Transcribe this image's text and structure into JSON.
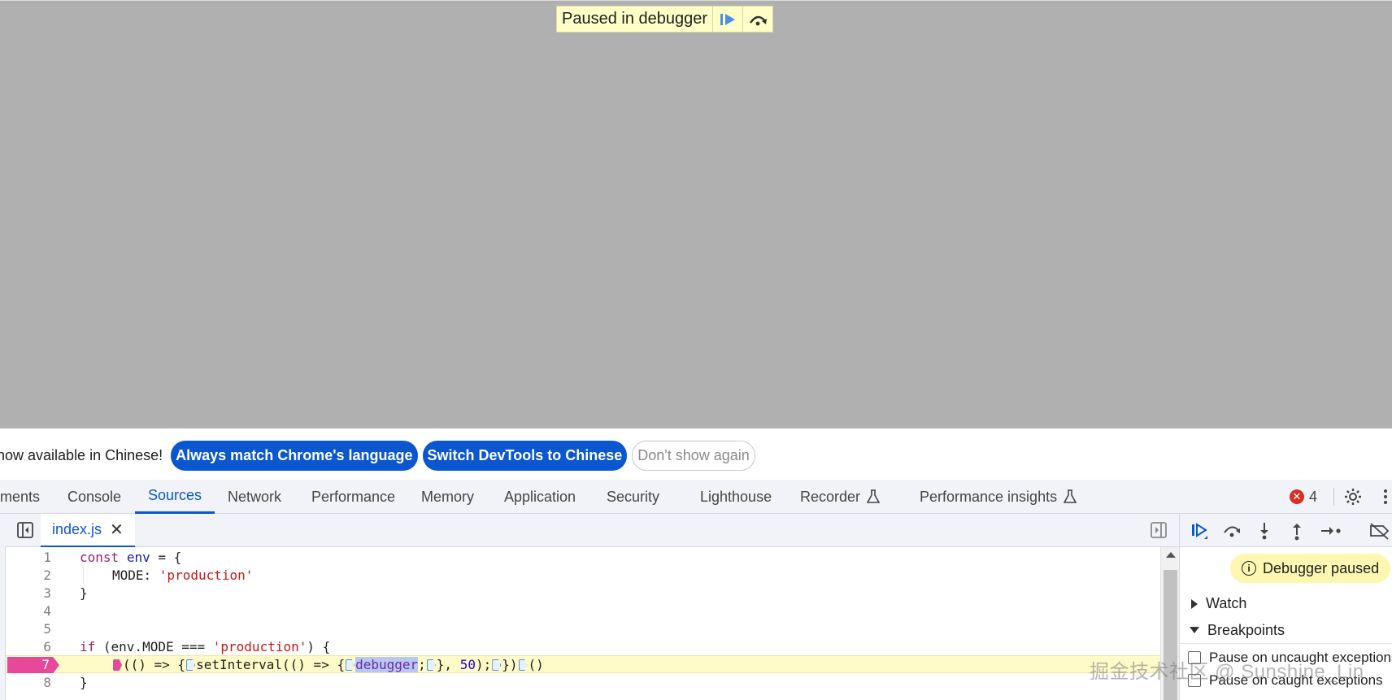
{
  "viewport": {
    "paused_label": "Paused in debugger"
  },
  "lang_bar": {
    "message": "now available in Chinese!",
    "always_match": "Always match Chrome's language",
    "switch_devtools": "Switch DevTools to Chinese",
    "dont_show": "Don't show again"
  },
  "tabs": {
    "elements": "ments",
    "console": "Console",
    "sources": "Sources",
    "network": "Network",
    "performance": "Performance",
    "memory": "Memory",
    "application": "Application",
    "security": "Security",
    "lighthouse": "Lighthouse",
    "recorder": "Recorder",
    "perf_insights": "Performance insights",
    "error_count": "4"
  },
  "editor": {
    "file_name": "index.js",
    "close_glyph": "✕",
    "lines": [
      {
        "n": "1"
      },
      {
        "n": "2"
      },
      {
        "n": "3"
      },
      {
        "n": "4"
      },
      {
        "n": "5"
      },
      {
        "n": "6"
      },
      {
        "n": "7"
      },
      {
        "n": "8"
      }
    ],
    "code": {
      "l1_kw": "const",
      "l1_id": "env",
      "l1_rest": " = {",
      "l2_key": "MODE: ",
      "l2_str": "'production'",
      "l3": "}",
      "l6_kw": "if",
      "l6_mid": " (env.MODE === ",
      "l6_str": "'production'",
      "l6_end": ") {",
      "l7_a": "(() => {",
      "l7_b": "setInterval(() => {",
      "l7_dbg": "debugger",
      "l7_c": ";",
      "l7_d": "}, ",
      "l7_num": "50",
      "l7_e": ");",
      "l7_f": "})",
      "l7_g": "()",
      "l8": "}"
    }
  },
  "side": {
    "paused_badge": "Debugger paused",
    "info_glyph": "i",
    "watch": "Watch",
    "breakpoints": "Breakpoints",
    "pause_uncaught": "Pause on uncaught exceptions",
    "pause_caught": "Pause on caught exceptions"
  },
  "watermark": "掘金技术社区 @ Sunshine_Lin",
  "colors": {
    "accent": "#0b57d0",
    "breakpoint": "#e8489a",
    "paused_bg": "#ffffc8",
    "viewport_bg": "#b0b0b0"
  }
}
